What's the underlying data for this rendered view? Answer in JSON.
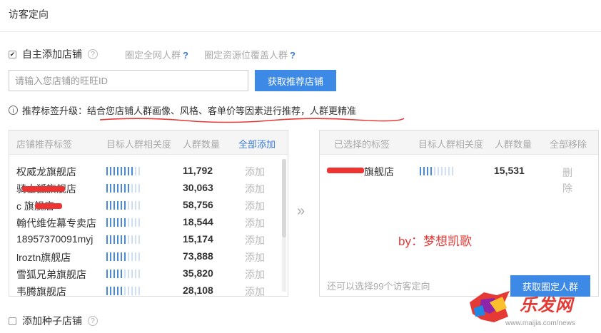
{
  "title": "访客定向",
  "self_add": {
    "label": "自主添加店铺",
    "checked": true,
    "help": "?"
  },
  "links": [
    {
      "label": "圈定全网人群",
      "q": "?"
    },
    {
      "label": "圈定资源位覆盖人群",
      "q": "?"
    }
  ],
  "search": {
    "placeholder": "请输入您店铺的旺旺ID",
    "button": "获取推荐店铺"
  },
  "tip": {
    "icon": "i",
    "text": "推荐标签升级：结合您店铺人群画像、风格、客单价等因素进行推荐，人群更精准"
  },
  "left_panel": {
    "headers": {
      "tag": "店铺推荐标签",
      "relevance": "目标人群相关度",
      "count": "人群数量",
      "add_all": "全部添加"
    },
    "rows": [
      {
        "name": "权威龙旗舰店",
        "level": 8,
        "count": "11,792",
        "action": "添加"
      },
      {
        "name": "骑士狐旗舰店",
        "level": 7,
        "count": "30,063",
        "action": "添加"
      },
      {
        "name": "c    旗舰店",
        "level": 6,
        "count": "58,756",
        "action": "添加"
      },
      {
        "name": "翰代维佐幕专卖店",
        "level": 6,
        "count": "18,544",
        "action": "添加"
      },
      {
        "name": "18957370091myj",
        "level": 6,
        "count": "15,174",
        "action": "添加"
      },
      {
        "name": "lroztn旗舰店",
        "level": 6,
        "count": "73,888",
        "action": "添加"
      },
      {
        "name": "雪狐兄弟旗舰店",
        "level": 5,
        "count": "35,820",
        "action": "添加"
      },
      {
        "name": "韦腾旗舰店",
        "level": 5,
        "count": "28,108",
        "action": "添加"
      }
    ]
  },
  "transfer_arrow": "»",
  "right_panel": {
    "headers": {
      "tag": "已选择的标签",
      "relevance": "目标人群相关度",
      "count": "人群数量",
      "remove_all": "全部移除"
    },
    "rows": [
      {
        "name": "旗舰店",
        "level": 4,
        "count": "15,531",
        "action": "删除"
      }
    ],
    "remain_text": "还可以选择99个访客定向",
    "button": "获取圈定人群"
  },
  "watermark_by": "by：梦想凯歌",
  "seed": {
    "label": "添加种子店铺",
    "checked": false,
    "help": "?"
  },
  "logo": {
    "brand": "乐发网",
    "url": "www.maijia.com/news"
  },
  "colors": {
    "primary": "#3d8ae6",
    "link": "#3d7bd9",
    "accent_red": "#e53935"
  }
}
